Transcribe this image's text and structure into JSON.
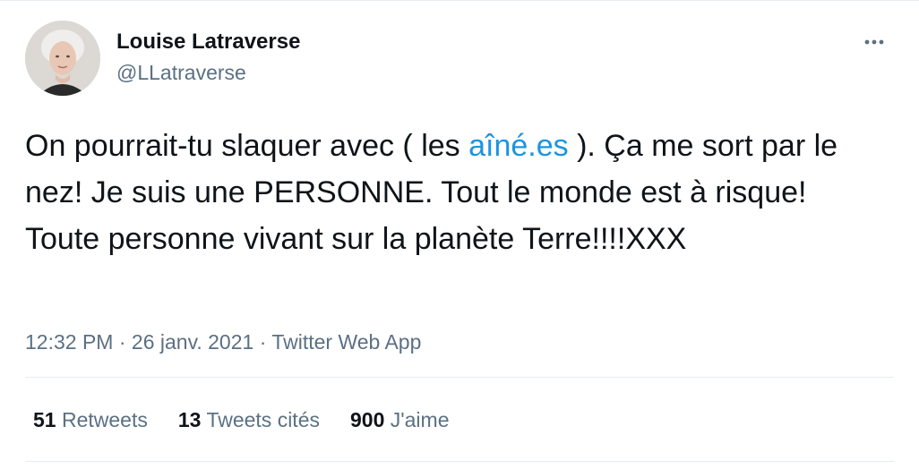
{
  "author": {
    "name": "Louise Latraverse",
    "handle": "@LLatraverse",
    "more_icon": "more-horizontal-icon"
  },
  "tweet": {
    "text_before": "On pourrait-tu slaquer avec ( les ",
    "link_text": "aîné.es",
    "text_after": " ). Ça me sort par le nez! Je suis une PERSONNE. Tout le monde est à risque! Toute personne vivant sur la planète Terre!!!!XXX"
  },
  "meta": {
    "time": "12:32 PM",
    "separator": " · ",
    "date": "26 janv. 2021",
    "source": "Twitter Web App"
  },
  "stats": {
    "retweets_count": "51",
    "retweets_label": "Retweets",
    "quotes_count": "13",
    "quotes_label": "Tweets cités",
    "likes_count": "900",
    "likes_label": "J'aime"
  },
  "colors": {
    "link": "#1b95e0",
    "secondary_text": "#5b7083",
    "primary_text": "#0f1419",
    "divider": "#e6ecf0"
  }
}
